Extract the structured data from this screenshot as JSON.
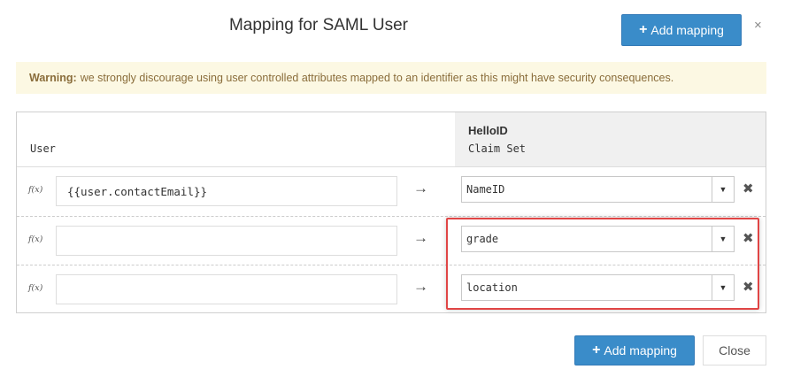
{
  "modal": {
    "title": "Mapping for SAML User",
    "add_mapping_label": "Add mapping",
    "close_symbol": "×"
  },
  "warning": {
    "bold": "Warning:",
    "text": "we strongly discourage using user controlled attributes mapped to an identifier as this might have security consequences."
  },
  "table": {
    "left_header": "User",
    "right_header_title": "HelloID",
    "right_header_sub": "Claim Set",
    "rows": [
      {
        "fx": "f(x)",
        "value": "{{user.contactEmail}}",
        "arrow": "→",
        "claim": "NameID"
      },
      {
        "fx": "f(x)",
        "value": "",
        "arrow": "→",
        "claim": "grade"
      },
      {
        "fx": "f(x)",
        "value": "",
        "arrow": "→",
        "claim": "location"
      }
    ],
    "caret": "▼",
    "remove_symbol": "✖"
  },
  "footer": {
    "add_mapping_label": "Add mapping",
    "close_label": "Close"
  },
  "colors": {
    "primary": "#3a8cc9",
    "warning_bg": "#fcf8e3",
    "warning_text": "#8a6d3b",
    "highlight": "#e04545"
  },
  "icons": {
    "plus": "plus-icon",
    "close": "close-icon",
    "function": "function-icon",
    "arrow": "arrow-right-icon",
    "caret": "caret-down-icon",
    "remove": "remove-icon"
  }
}
